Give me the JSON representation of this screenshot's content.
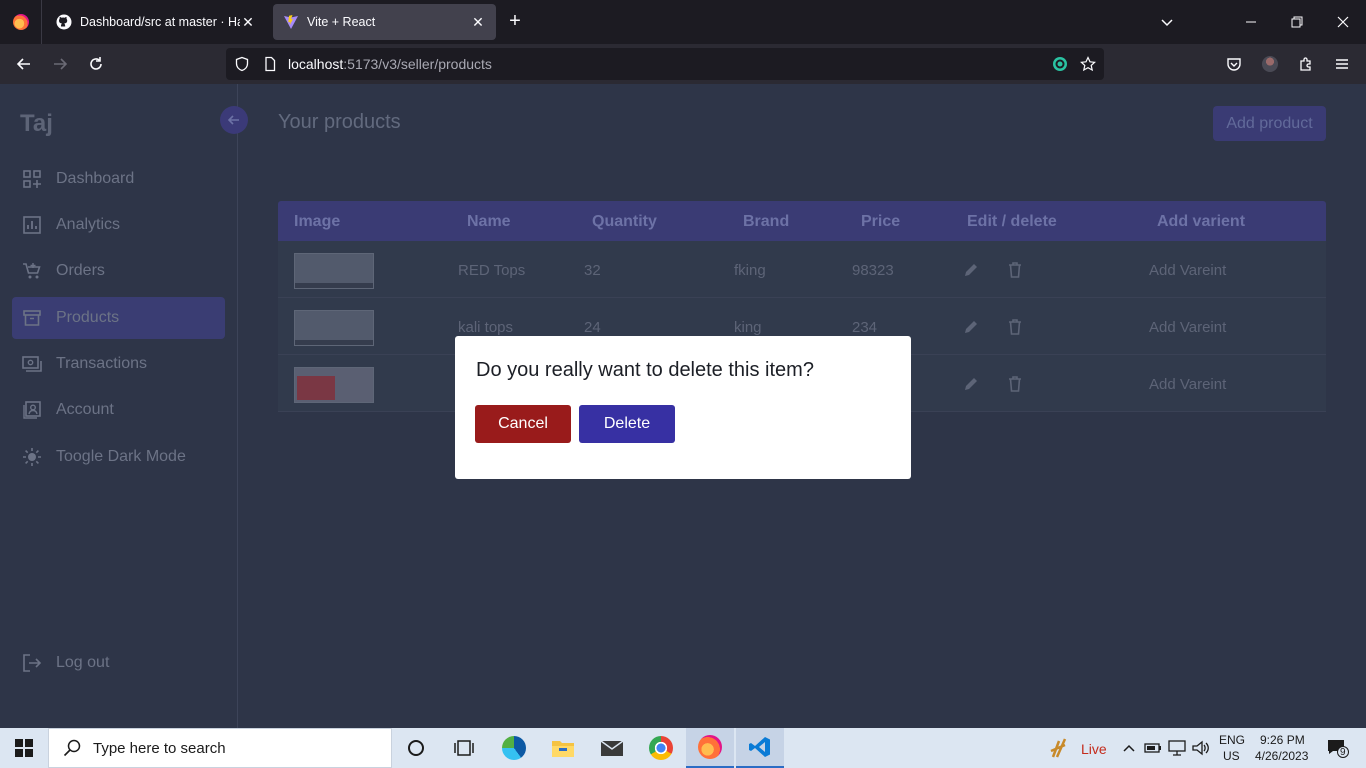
{
  "browser": {
    "tabs": [
      {
        "title": "Dashboard/src at master · Hayat",
        "favicon": "github-icon"
      },
      {
        "title": "Vite + React",
        "favicon": "vite-icon",
        "active": true
      }
    ],
    "url_host": "localhost",
    "url_path": ":5173/v3/seller/products"
  },
  "app": {
    "brand": "Taj",
    "sidebar": {
      "items": [
        {
          "label": "Dashboard",
          "icon": "grid-icon"
        },
        {
          "label": "Analytics",
          "icon": "chart-icon"
        },
        {
          "label": "Orders",
          "icon": "cart-icon"
        },
        {
          "label": "Products",
          "icon": "archive-icon",
          "active": true
        },
        {
          "label": "Transactions",
          "icon": "cash-icon"
        },
        {
          "label": "Account",
          "icon": "contact-icon"
        },
        {
          "label": "Toogle Dark Mode",
          "icon": "sun-icon"
        }
      ],
      "logout": "Log out"
    },
    "page_title": "Your products",
    "add_product": "Add product",
    "table": {
      "headers": [
        "Image",
        "Name",
        "Quantity",
        "Brand",
        "Price",
        "Edit / delete",
        "Add varient"
      ],
      "rows": [
        {
          "name": "RED Tops",
          "quantity": "32",
          "brand": "fking",
          "price": "98323",
          "action": "Add Vareint"
        },
        {
          "name": "kali tops",
          "quantity": "24",
          "brand": "king",
          "price": "234",
          "action": "Add Vareint"
        },
        {
          "name": "",
          "quantity": "",
          "brand": "",
          "price": "",
          "action": "Add Vareint"
        }
      ]
    }
  },
  "modal": {
    "message": "Do you really want to delete this item?",
    "cancel": "Cancel",
    "delete": "Delete"
  },
  "taskbar": {
    "search_placeholder": "Type here to search",
    "live": "Live",
    "lang": "ENG",
    "region": "US",
    "time": "9:26 PM",
    "date": "4/26/2023",
    "notifications": "9"
  },
  "colors": {
    "app_bg": "#2e3548",
    "accent": "#3a3b74",
    "cancel": "#991b1b",
    "delete": "#3730a3"
  }
}
